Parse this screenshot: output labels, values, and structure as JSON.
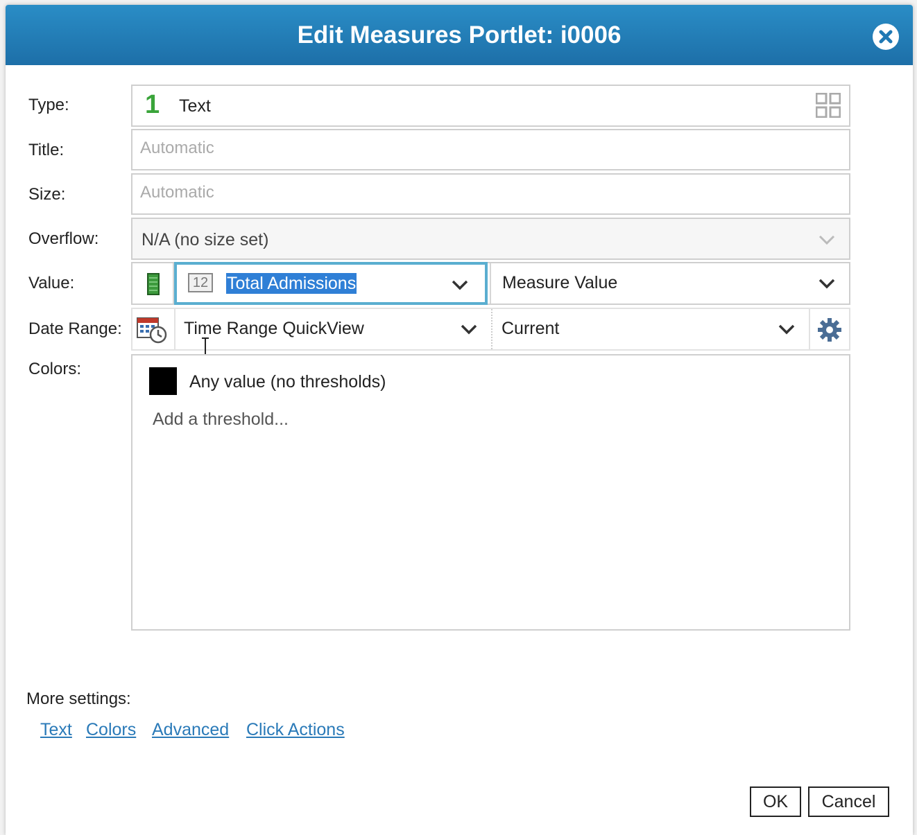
{
  "dialog": {
    "title": "Edit Measures Portlet: i0006",
    "close_icon": "close-circle-icon"
  },
  "type_row": {
    "label": "Type:",
    "badge": "1",
    "value": "Text",
    "picker_icon": "grid-icon"
  },
  "title_row": {
    "label": "Title:",
    "placeholder": "Automatic"
  },
  "size_row": {
    "label": "Size:",
    "placeholder": "Automatic"
  },
  "overflow_row": {
    "label": "Overflow:",
    "value": "N/A (no size set)"
  },
  "value_row": {
    "label": "Value:",
    "measure_icon": "measure-bar-icon",
    "measure_badge": "12",
    "measure": "Total Admissions",
    "aggregation": "Measure Value"
  },
  "date_range_row": {
    "label": "Date Range:",
    "calendar_icon": "calendar-clock-icon",
    "range": "Time Range QuickView",
    "period": "Current",
    "settings_icon": "gear-icon"
  },
  "colors_row": {
    "label": "Colors:",
    "swatch_color": "#000000",
    "any_value": "Any value (no thresholds)",
    "add_threshold": "Add a threshold..."
  },
  "more_settings": {
    "label": "More settings:",
    "links": [
      "Text",
      "Colors",
      "Advanced",
      "Click Actions"
    ]
  },
  "buttons": {
    "ok": "OK",
    "cancel": "Cancel"
  },
  "colors": {
    "title_bar": "#1f78b4",
    "link": "#2a7ab8",
    "focus": "#5aaed0",
    "selection": "#2f7fd6"
  }
}
